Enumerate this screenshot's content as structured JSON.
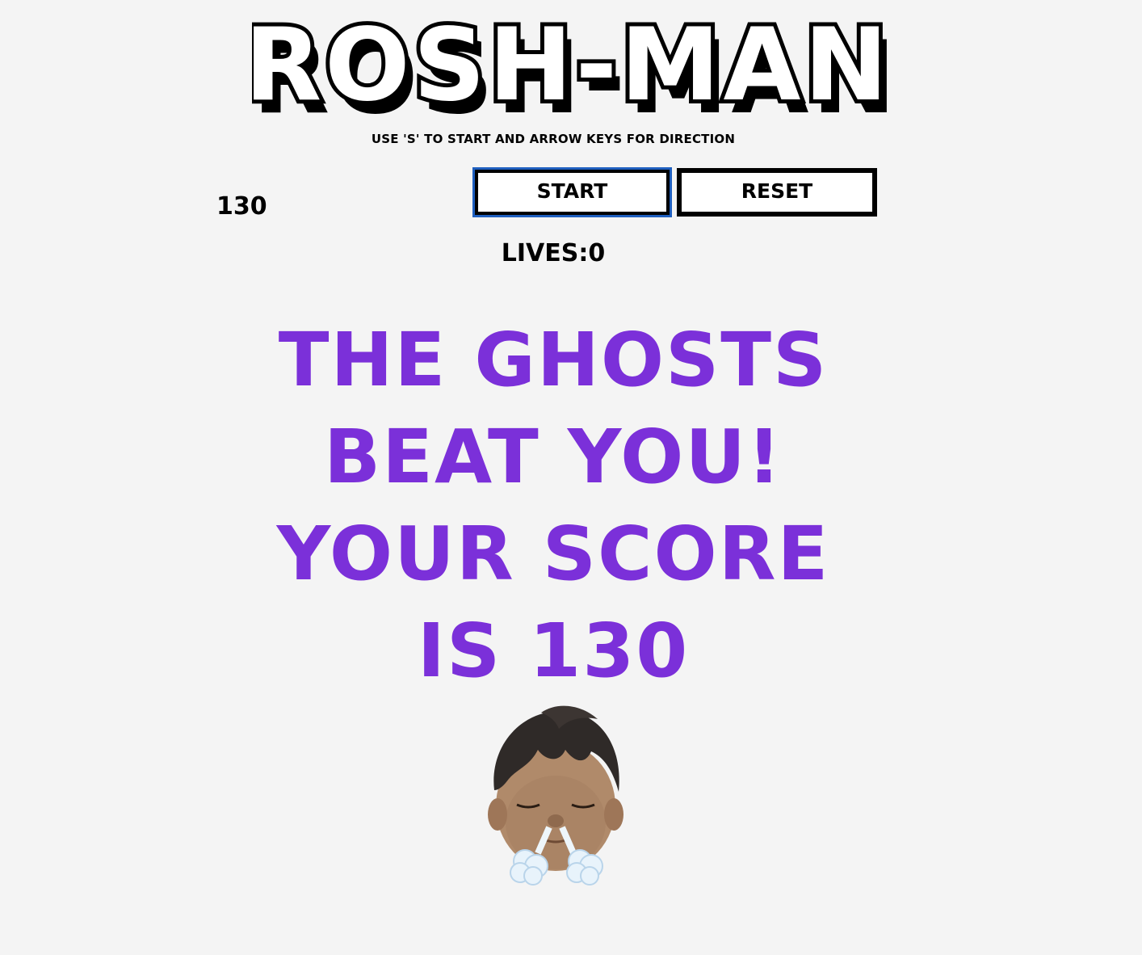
{
  "game": {
    "title": "ROSH-MAN",
    "instructions": "USE 'S' TO START AND ARROW KEYS FOR DIRECTION",
    "score": "130",
    "lives_text": "LIVES:0",
    "game_over_message": "THE GHOSTS BEAT YOU! YOUR SCORE IS 130"
  },
  "controls": {
    "start_label": "START",
    "reset_label": "RESET"
  },
  "colors": {
    "background": "#f4f4f4",
    "message": "#7b30d9",
    "focus_outline": "#1f5fbf"
  },
  "icons": {
    "avatar": "memoji-exhaling-avatar"
  }
}
